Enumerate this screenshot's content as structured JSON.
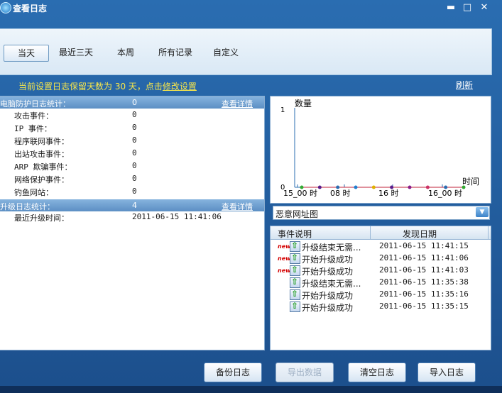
{
  "window": {
    "title": "查看日志",
    "controls": [
      "▬",
      "□",
      "✕"
    ]
  },
  "filters": [
    "当天",
    "最近三天",
    "本周",
    "所有记录",
    "自定义"
  ],
  "info": {
    "prefix": "当前设置日志保留天数为 30 天，点击",
    "link": "修改设置",
    "refresh": "刷新"
  },
  "protection": {
    "header": "电脑防护日志统计：",
    "value": "0",
    "details": "查看详情",
    "items": [
      {
        "label": "攻击事件：",
        "value": "0"
      },
      {
        "label": "IP 事件：",
        "value": "0"
      },
      {
        "label": "程序联网事件：",
        "value": "0"
      },
      {
        "label": "出站攻击事件：",
        "value": "0"
      },
      {
        "label": "ARP 欺骗事件：",
        "value": "0"
      },
      {
        "label": "网络保护事件：",
        "value": "0"
      },
      {
        "label": "钓鱼网站：",
        "value": "0"
      }
    ]
  },
  "upgrade": {
    "header": "升级日志统计：",
    "value": "4",
    "details": "查看详情",
    "items": [
      {
        "label": "最近升级时间：",
        "value": "2011-06-15 11:41:06"
      }
    ]
  },
  "chart_data": {
    "type": "line",
    "ylabel": "数量",
    "xlabel": "时间",
    "ylim": [
      0,
      1
    ],
    "yticks": [
      "0",
      "1"
    ],
    "xticks": [
      "15_00 时",
      "08 时",
      "16 时",
      "16_00 时"
    ],
    "series": [
      {
        "values": [
          0,
          0,
          0,
          0,
          0,
          0,
          0,
          0,
          0,
          0
        ],
        "colors": [
          "#33aa33",
          "#5a1d8a",
          "#2a6db1",
          "#1f7fd0",
          "#e0b000",
          "#5a1d8a",
          "#8a1d8a",
          "#cc3366",
          "#2a6db1",
          "#33aa33"
        ]
      }
    ]
  },
  "chart_select": {
    "value": "恶意网址图"
  },
  "events": {
    "headers": [
      "事件说明",
      "发现日期"
    ],
    "rows": [
      {
        "new": "new",
        "desc": "升级结束无需...",
        "date": "2011-06-15 11:41:15"
      },
      {
        "new": "new",
        "desc": "开始升级成功",
        "date": "2011-06-15 11:41:06"
      },
      {
        "new": "new",
        "desc": "开始升级成功",
        "date": "2011-06-15 11:41:03"
      },
      {
        "new": "",
        "desc": "升级结束无需...",
        "date": "2011-06-15 11:35:38"
      },
      {
        "new": "",
        "desc": "开始升级成功",
        "date": "2011-06-15 11:35:16"
      },
      {
        "new": "",
        "desc": "开始升级成功",
        "date": "2011-06-15 11:35:15"
      }
    ]
  },
  "buttons": {
    "backup": "备份日志",
    "export": "导出数据",
    "clear": "清空日志",
    "import": "导入日志"
  }
}
